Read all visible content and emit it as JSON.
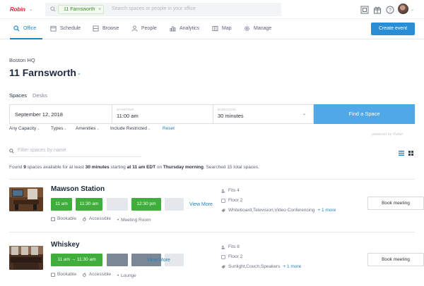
{
  "topbar": {
    "logo": "Robin",
    "search_chip": "11 Farnsworth",
    "search_chip_close": "×",
    "search_placeholder": "Search spaces or people in your office",
    "icons": [
      "qr-code-icon",
      "gift-icon",
      "help-icon",
      "avatar"
    ]
  },
  "nav": {
    "items": [
      {
        "label": "Office",
        "icon": "search-icon",
        "active": true
      },
      {
        "label": "Schedule",
        "icon": "calendar-icon",
        "active": false
      },
      {
        "label": "Browse",
        "icon": "browse-icon",
        "active": false
      },
      {
        "label": "People",
        "icon": "person-icon",
        "active": false
      },
      {
        "label": "Analytics",
        "icon": "bar-chart-icon",
        "active": false
      },
      {
        "label": "Map",
        "icon": "map-icon",
        "active": false
      },
      {
        "label": "Manage",
        "icon": "gear-icon",
        "active": false
      }
    ],
    "create_event": "Create event"
  },
  "header": {
    "building": "Boston HQ",
    "office": "11 Farnsworth",
    "tabs": [
      "Spaces",
      "Desks"
    ]
  },
  "form": {
    "date": "September 12, 2018",
    "starting_label": "STARTING",
    "starting_value": "11:00 am",
    "duration_label": "DURATION",
    "duration_value": "30 minutes",
    "find_button": "Find a Space"
  },
  "filters": {
    "items": [
      "Any Capacity",
      "Types",
      "Amenities",
      "Include Restricted"
    ],
    "reset": "Reset",
    "powered_by": "powered by Robin"
  },
  "name_filter": {
    "placeholder": "Filter spaces by name"
  },
  "summary": {
    "p1": "Found ",
    "count": "9",
    "p2": " spaces available for at least ",
    "duration": "30 minutes",
    "p3": " starting ",
    "time": "at 11 am EDT",
    "p4": " on ",
    "day": "Thursday morning",
    "p5": ". Searched 15 total spaces."
  },
  "spaces": [
    {
      "name": "Mawson Station",
      "slots": [
        "11 am",
        "11:30 am",
        "",
        "12:30 pm",
        ""
      ],
      "view_more": "View More",
      "tags": [
        "Bookable",
        "Accessible",
        "Meeting Room"
      ],
      "fits": "Fits 4",
      "floor": "Floor 2",
      "amenities": "Whiteboard,Television,Video Conferencing",
      "more": "+ 1 more",
      "book": "Book meeting"
    },
    {
      "name": "Whiskey",
      "slots": [
        "11 am → 11:30 am",
        "",
        "",
        ""
      ],
      "view_more": "View More",
      "tags": [
        "Bookable",
        "Accessible",
        "Lounge"
      ],
      "fits": "Fits 8",
      "floor": "Floor 2",
      "amenities": "Sunlight,Couch,Speakers",
      "more": "+ 1 more",
      "book": "Book meeting"
    }
  ],
  "colors": {
    "accent": "#1a83c4",
    "find_button": "#4fa9e9",
    "available": "#3fae3c",
    "booked": "#7b8794",
    "logo": "#e0263e"
  }
}
